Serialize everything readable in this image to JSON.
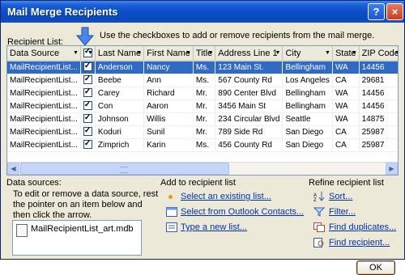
{
  "window": {
    "title": "Mail Merge Recipients",
    "help_label": "?",
    "close_label": "×"
  },
  "instruction": "Use the checkboxes to add or remove recipients from the mail merge.",
  "recipient_list_label": {
    "before": "",
    "ul": "R",
    "after": "ecipient List:"
  },
  "columns": [
    "Data Source",
    "",
    "Last Name",
    "First Name",
    "Title",
    "Address Line 1",
    "City",
    "State",
    "ZIP Code"
  ],
  "rows": [
    {
      "source": "MailRecipientList...",
      "last": "Anderson",
      "first": "Nancy",
      "title": "Ms.",
      "addr": "123 Main St.",
      "city": "Bellingham",
      "state": "WA",
      "zip": "14456"
    },
    {
      "source": "MailRecipientList...",
      "last": "Beebe",
      "first": "Ann",
      "title": "Ms.",
      "addr": "567 County Rd",
      "city": "Los Angeles",
      "state": "CA",
      "zip": "29681"
    },
    {
      "source": "MailRecipientList...",
      "last": "Carey",
      "first": "Richard",
      "title": "Mr.",
      "addr": "890 Center Blvd",
      "city": "Bellingham",
      "state": "WA",
      "zip": "14456"
    },
    {
      "source": "MailRecipientList...",
      "last": "Con",
      "first": "Aaron",
      "title": "Mr.",
      "addr": "3456 Main St",
      "city": "Bellingham",
      "state": "WA",
      "zip": "14456"
    },
    {
      "source": "MailRecipientList...",
      "last": "Johnson",
      "first": "Willis",
      "title": "Mr.",
      "addr": "234 Circular Blvd",
      "city": "Seattle",
      "state": "WA",
      "zip": "14875"
    },
    {
      "source": "MailRecipientList...",
      "last": "Koduri",
      "first": "Sunil",
      "title": "Mr.",
      "addr": "789 Side Rd",
      "city": "San Diego",
      "state": "CA",
      "zip": "25987"
    },
    {
      "source": "MailRecipientList...",
      "last": "Zimprich",
      "first": "Karin",
      "title": "Ms.",
      "addr": "456 County Rd",
      "city": "San Diego",
      "state": "CA",
      "zip": "25987"
    }
  ],
  "data_sources": {
    "heading": "Data sources:",
    "note": "To edit or remove a data source, rest the pointer on an item below and then click the arrow.",
    "items": [
      "MailRecipientList_art.mdb"
    ]
  },
  "add_list": {
    "heading": "Add to recipient list",
    "links": [
      "Select an existing list...",
      "Select from Outlook Contacts...",
      "Type a new list..."
    ]
  },
  "refine": {
    "heading": "Refine recipient list",
    "links": [
      "Sort...",
      "Filter...",
      "Find duplicates...",
      "Find recipient..."
    ]
  },
  "ok_label": "OK",
  "colors": {
    "title_bar": "#0a4fc9",
    "selection": "#316ac5",
    "link": "#0033aa",
    "dialog_bg": "#ece9d8"
  }
}
